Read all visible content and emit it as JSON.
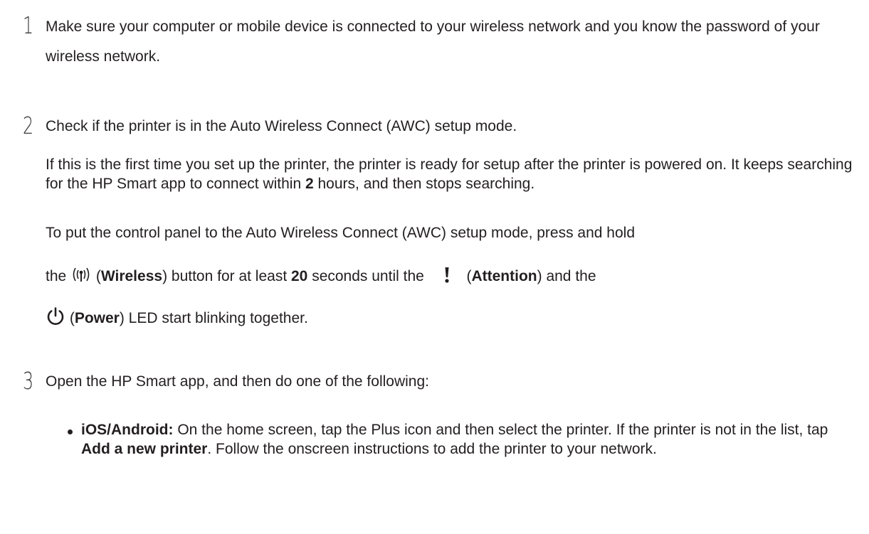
{
  "steps": [
    {
      "number": "1",
      "text": "Make sure your computer or mobile device is connected to your wireless network and you know the password of your wireless network."
    },
    {
      "number": "2",
      "text": "Check if the printer is in the Auto Wireless Connect (AWC) setup mode.",
      "para1": {
        "before": "If this is the first time you set up the printer, the printer is ready for setup after the printer is powered on. It keeps searching for the HP Smart app to connect within ",
        "hours": "2",
        "after": " hours, and then stops searching."
      },
      "para2": {
        "line1": "To put the control panel to the Auto Wireless Connect (AWC) setup mode, press and hold",
        "the1": "the ",
        "wireless_open": " (",
        "wireless": "Wireless",
        "wireless_close": ") button for at least ",
        "seconds": "20",
        "seconds_after": " seconds until the ",
        "attention_open": " (",
        "attention": "Attention",
        "attention_close": ") and the",
        "power_open": " (",
        "power": "Power",
        "power_close": ") LED start blinking together."
      }
    },
    {
      "number": "3",
      "text": "Open the HP Smart app, and then do one of the following:",
      "bullet": {
        "label": "iOS/Android:",
        "before": " On the home screen, tap the Plus icon and then select the printer. If the printer is not in the list, tap ",
        "link": "Add a new printer",
        "after": ". Follow the onscreen instructions to add the printer to your network."
      }
    }
  ],
  "colors": {
    "accent": "#0096d6",
    "text": "#231f20"
  },
  "icons": [
    "wireless-icon",
    "attention-icon",
    "power-icon"
  ]
}
